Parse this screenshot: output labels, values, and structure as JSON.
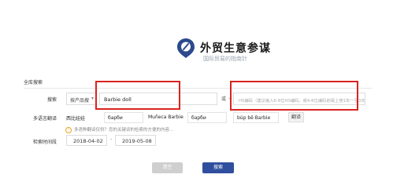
{
  "logo": {
    "icon": "map-pin-logo-icon",
    "title": "外贸生意参谋",
    "subtitle": "国际贸易的指南针"
  },
  "section": {
    "label": "全库搜索"
  },
  "search": {
    "label": "搜索",
    "mode_select": "按产品搜",
    "keyword_value": "Barbie doll",
    "or_label": "或",
    "hs_placeholder": "HS编码（建议输入6-8位HS编码，或4-6位编码前缀上搜1年一至3年）"
  },
  "translations": {
    "label": "多语言翻译",
    "items": [
      {
        "lang": "西比娃娃",
        "value": "барби"
      },
      {
        "lang": "Muñeca Barbie",
        "value": "барби"
      },
      {
        "lang": "",
        "value": "búp bê Barbie"
      }
    ],
    "translate_button": "翻译",
    "warning": "多语种翻译仅供？您的关键词的检索的方便的内容..."
  },
  "date": {
    "label": "检索时间段",
    "start": "2018-04-02",
    "separator": "-",
    "end": "2019-05-08"
  },
  "actions": {
    "clear_label": "清空",
    "search_label": "搜索"
  },
  "colors": {
    "highlight": "#d9231f",
    "primary": "#2f4f9e",
    "logo": "#2c4a8c"
  }
}
